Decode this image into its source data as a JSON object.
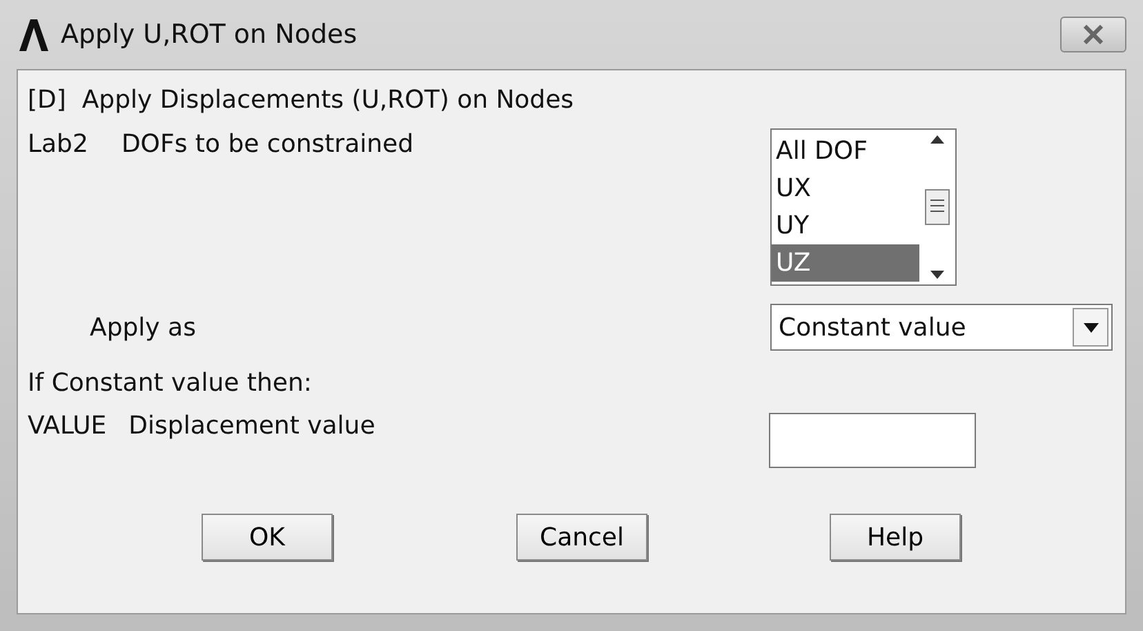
{
  "window": {
    "title": "Apply U,ROT on Nodes"
  },
  "heading": "[D]  Apply Displacements (U,ROT) on Nodes",
  "dofs": {
    "prefix": "Lab2",
    "label": "DOFs to be constrained",
    "options": [
      {
        "label": "All DOF",
        "selected": false
      },
      {
        "label": "UX",
        "selected": false
      },
      {
        "label": "UY",
        "selected": false
      },
      {
        "label": "UZ",
        "selected": true
      }
    ]
  },
  "apply_as": {
    "label": "Apply as",
    "value": "Constant value"
  },
  "note": "If Constant value then:",
  "value_field": {
    "prefix": "VALUE",
    "label": "Displacement value"
  },
  "buttons": [
    "OK",
    "Cancel",
    "Help"
  ]
}
